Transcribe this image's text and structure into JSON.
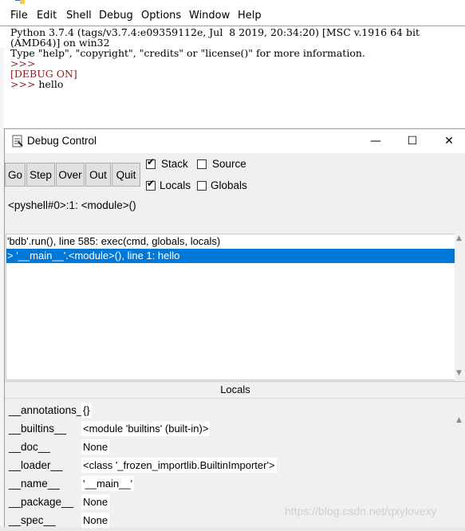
{
  "shell": {
    "menu": [
      "File",
      "Edit",
      "Shell",
      "Debug",
      "Options",
      "Window",
      "Help"
    ],
    "lines": {
      "banner1": "Python 3.7.4 (tags/v3.7.4:e09359112e, Jul  8 2019, 20:34:20) [MSC v.1916 64 bit",
      "banner2": "(AMD64)] on win32",
      "banner3": "Type \"help\", \"copyright\", \"credits\" or \"license()\" for more information.",
      "prompt1": ">>> ",
      "debug_on": "[DEBUG ON]",
      "prompt2": ">>> ",
      "command": "hello"
    }
  },
  "debug": {
    "title": "Debug Control",
    "window_controls": {
      "minimize": "—",
      "maximize": "☐",
      "close": "✕"
    },
    "buttons": [
      "Go",
      "Step",
      "Over",
      "Out",
      "Quit"
    ],
    "checkboxes": {
      "stack": {
        "label": "Stack",
        "checked": true
      },
      "source": {
        "label": "Source",
        "checked": false
      },
      "locals": {
        "label": "Locals",
        "checked": true
      },
      "globals": {
        "label": "Globals",
        "checked": false
      }
    },
    "status": "<pyshell#0>:1: <module>()",
    "stack": [
      "'bdb'.run(), line 585: exec(cmd, globals, locals)",
      "> '__main__'.<module>(), line 1: hello"
    ],
    "locals_header": "Locals",
    "locals": [
      {
        "name": "__annotations__",
        "value": "{}"
      },
      {
        "name": "__builtins__",
        "value": "<module 'builtins' (built-in)>"
      },
      {
        "name": "__doc__",
        "value": "None"
      },
      {
        "name": "__loader__",
        "value": "<class '_frozen_importlib.BuiltinImporter'>"
      },
      {
        "name": "__name__",
        "value": "'__main__'"
      },
      {
        "name": "__package__",
        "value": "None"
      },
      {
        "name": "__spec__",
        "value": "None"
      }
    ]
  },
  "watermark": "https://blog.csdn.net/qxylovexy",
  "colors": {
    "selection": "#0078d7",
    "prompt": "#8b2020"
  }
}
